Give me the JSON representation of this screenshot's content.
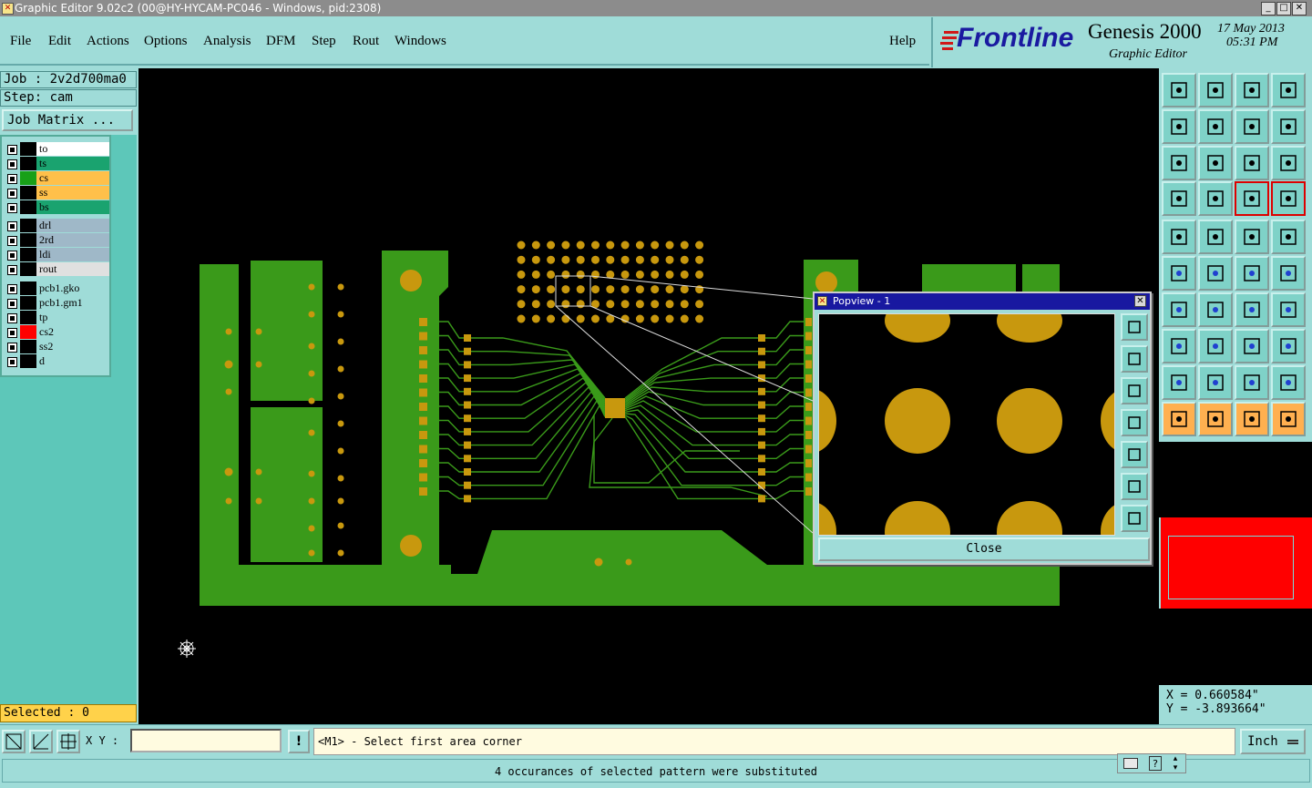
{
  "window": {
    "title": "Graphic Editor 9.02c2 (00@HY-HYCAM-PC046 - Windows, pid:2308)"
  },
  "menu": {
    "items": [
      "File",
      "Edit",
      "Actions",
      "Options",
      "Analysis",
      "DFM",
      "Step",
      "Rout",
      "Windows"
    ],
    "help": "Help"
  },
  "brand": {
    "logo": "Frontline",
    "product": "Genesis 2000",
    "subtitle": "Graphic Editor",
    "date": "17 May 2013",
    "time": "05:31 PM"
  },
  "job": {
    "job_label": "Job : 2v2d700ma0",
    "step_label": "Step: cam",
    "matrix_button": "Job Matrix ..."
  },
  "layers": [
    {
      "name": "to",
      "color": "#ffffff",
      "swatch": "#000000"
    },
    {
      "name": "ts",
      "color": "#1aa36f",
      "swatch": "#000000"
    },
    {
      "name": "cs",
      "color": "#ffc04a",
      "swatch": "#18a018"
    },
    {
      "name": "ss",
      "color": "#ffc04a",
      "swatch": "#000000"
    },
    {
      "name": "bs",
      "color": "#1aa36f",
      "swatch": "#000000"
    },
    {
      "name": "drl",
      "color": "#9fb8c8",
      "swatch": "#000000"
    },
    {
      "name": "2rd",
      "color": "#9fb8c8",
      "swatch": "#000000"
    },
    {
      "name": "ldi",
      "color": "#9fb8c8",
      "swatch": "#000000"
    },
    {
      "name": "rout",
      "color": "#e0e0e0",
      "swatch": "#000000"
    },
    {
      "name": "pcb1.gko",
      "color": "#9fdcd8",
      "swatch": "#000000"
    },
    {
      "name": "pcb1.gm1",
      "color": "#9fdcd8",
      "swatch": "#000000"
    },
    {
      "name": "tp",
      "color": "#9fdcd8",
      "swatch": "#000000"
    },
    {
      "name": "cs2",
      "color": "#9fdcd8",
      "swatch": "#ff0000"
    },
    {
      "name": "ss2",
      "color": "#9fdcd8",
      "swatch": "#000000"
    },
    {
      "name": "d",
      "color": "#9fdcd8",
      "swatch": "#000000"
    }
  ],
  "status": {
    "selected": "Selected : 0"
  },
  "bottom": {
    "xy_label": "X Y :",
    "xy_value": "",
    "prompt": "<M1> - Select first area corner",
    "units": "Inch",
    "message": "4 occurances of selected pattern were substituted"
  },
  "coords": {
    "x": "X = 0.660584\"",
    "y": "Y = -3.893664\""
  },
  "popview": {
    "title": "Popview - 1",
    "close_label": "Close"
  },
  "colors": {
    "board": "#3a9a1a",
    "pad": "#c8980e",
    "canvas": "#000000",
    "panel": "#9fdcd8"
  }
}
